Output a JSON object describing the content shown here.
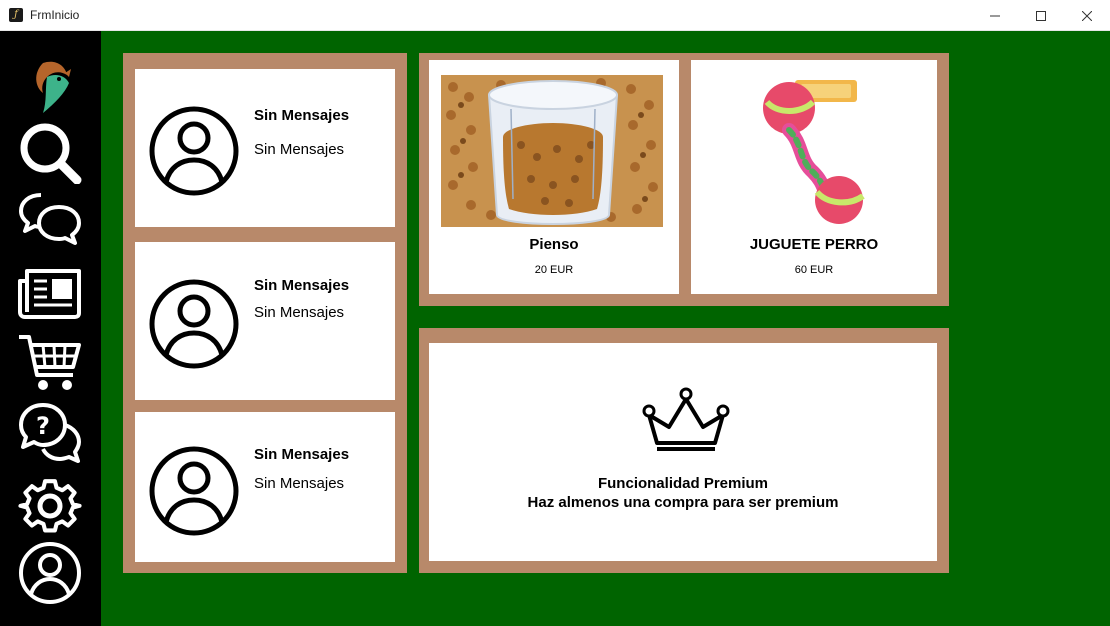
{
  "window": {
    "title": "FrmInicio"
  },
  "sidebar": {
    "items": [
      {
        "icon": "logo-icon",
        "name": "logo"
      },
      {
        "icon": "search-icon",
        "name": "search"
      },
      {
        "icon": "chat-bubbles-icon",
        "name": "messages"
      },
      {
        "icon": "newspaper-icon",
        "name": "news"
      },
      {
        "icon": "shopping-cart-icon",
        "name": "shop"
      },
      {
        "icon": "help-bubble-icon",
        "name": "help"
      },
      {
        "icon": "gear-icon",
        "name": "settings"
      },
      {
        "icon": "user-icon",
        "name": "profile"
      }
    ]
  },
  "messages": [
    {
      "title": "Sin Mensajes",
      "text": "Sin Mensajes"
    },
    {
      "title": "Sin Mensajes",
      "text": "Sin Mensajes"
    },
    {
      "title": "Sin Mensajes",
      "text": "Sin Mensajes"
    }
  ],
  "products": [
    {
      "name": "Pienso",
      "price": "20 EUR"
    },
    {
      "name": "JUGUETE PERRO",
      "price": "60 EUR"
    }
  ],
  "premium": {
    "icon": "crown-icon",
    "title": "Funcionalidad Premium",
    "description": "Haz almenos una compra para ser premium"
  },
  "colors": {
    "background": "#006400",
    "sidebar": "#000000",
    "panel_border": "#b8896a",
    "card": "#ffffff"
  }
}
